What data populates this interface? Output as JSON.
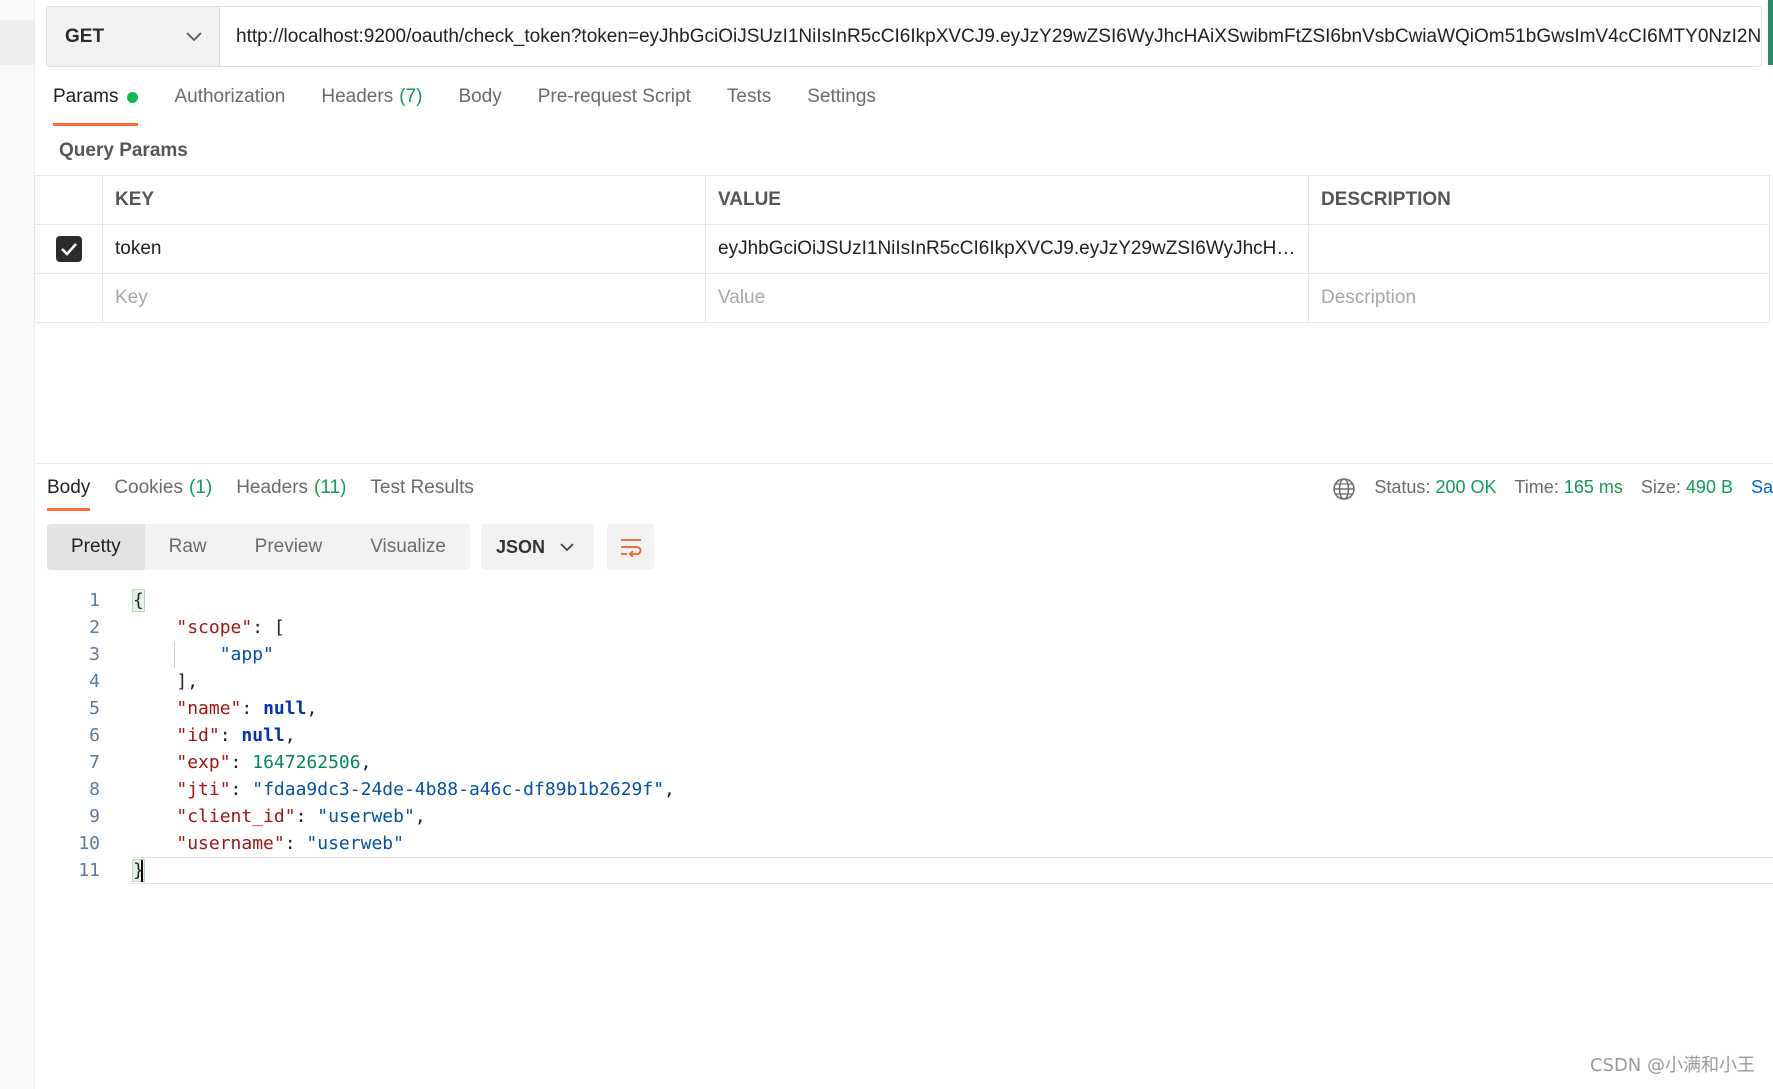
{
  "request": {
    "method": "GET",
    "url": "http://localhost:9200/oauth/check_token?token=eyJhbGciOiJSUzI1NiIsInR5cCI6IkpXVCJ9.eyJzY29wZSI6WyJhcHAiXSwibmFtZSI6bnVsbCwiaWQiOm51bGwsImV4cCI6MTY0NzI2N"
  },
  "request_tabs": [
    {
      "label": "Params",
      "count": ""
    },
    {
      "label": "Authorization",
      "count": ""
    },
    {
      "label": "Headers",
      "count": "(7)"
    },
    {
      "label": "Body",
      "count": ""
    },
    {
      "label": "Pre-request Script",
      "count": ""
    },
    {
      "label": "Tests",
      "count": ""
    },
    {
      "label": "Settings",
      "count": ""
    }
  ],
  "query_params": {
    "title": "Query Params",
    "columns": [
      "KEY",
      "VALUE",
      "DESCRIPTION"
    ],
    "rows": [
      {
        "checked": true,
        "key": "token",
        "value": "eyJhbGciOiJSUzI1NiIsInR5cCI6IkpXVCJ9.eyJzY29wZSI6WyJhcHAi...",
        "description": ""
      }
    ],
    "placeholders": {
      "key": "Key",
      "value": "Value",
      "description": "Description"
    }
  },
  "response_tabs": [
    {
      "label": "Body",
      "count": ""
    },
    {
      "label": "Cookies",
      "count": "(1)"
    },
    {
      "label": "Headers",
      "count": "(11)"
    },
    {
      "label": "Test Results",
      "count": ""
    }
  ],
  "status": {
    "status_label": "Status:",
    "status_value": "200 OK",
    "time_label": "Time:",
    "time_value": "165 ms",
    "size_label": "Size:",
    "size_value": "490 B",
    "save": "Sa"
  },
  "view_modes": [
    "Pretty",
    "Raw",
    "Preview",
    "Visualize"
  ],
  "format": "JSON",
  "code_lines": [
    "1",
    "2",
    "3",
    "4",
    "5",
    "6",
    "7",
    "8",
    "9",
    "10",
    "11"
  ],
  "response_body": {
    "scope_key": "\"scope\"",
    "scope_item": "\"app\"",
    "name_key": "\"name\"",
    "name_val": "null",
    "id_key": "\"id\"",
    "id_val": "null",
    "exp_key": "\"exp\"",
    "exp_val": "1647262506",
    "jti_key": "\"jti\"",
    "jti_val": "\"fdaa9dc3-24de-4b88-a46c-df89b1b2629f\"",
    "client_id_key": "\"client_id\"",
    "client_id_val": "\"userweb\"",
    "username_key": "\"username\"",
    "username_val": "\"userweb\""
  },
  "watermark": "CSDN @小满和小王",
  "colors": {
    "accent": "#ff6c37",
    "success": "#0f9d58",
    "link": "#0265d2"
  }
}
